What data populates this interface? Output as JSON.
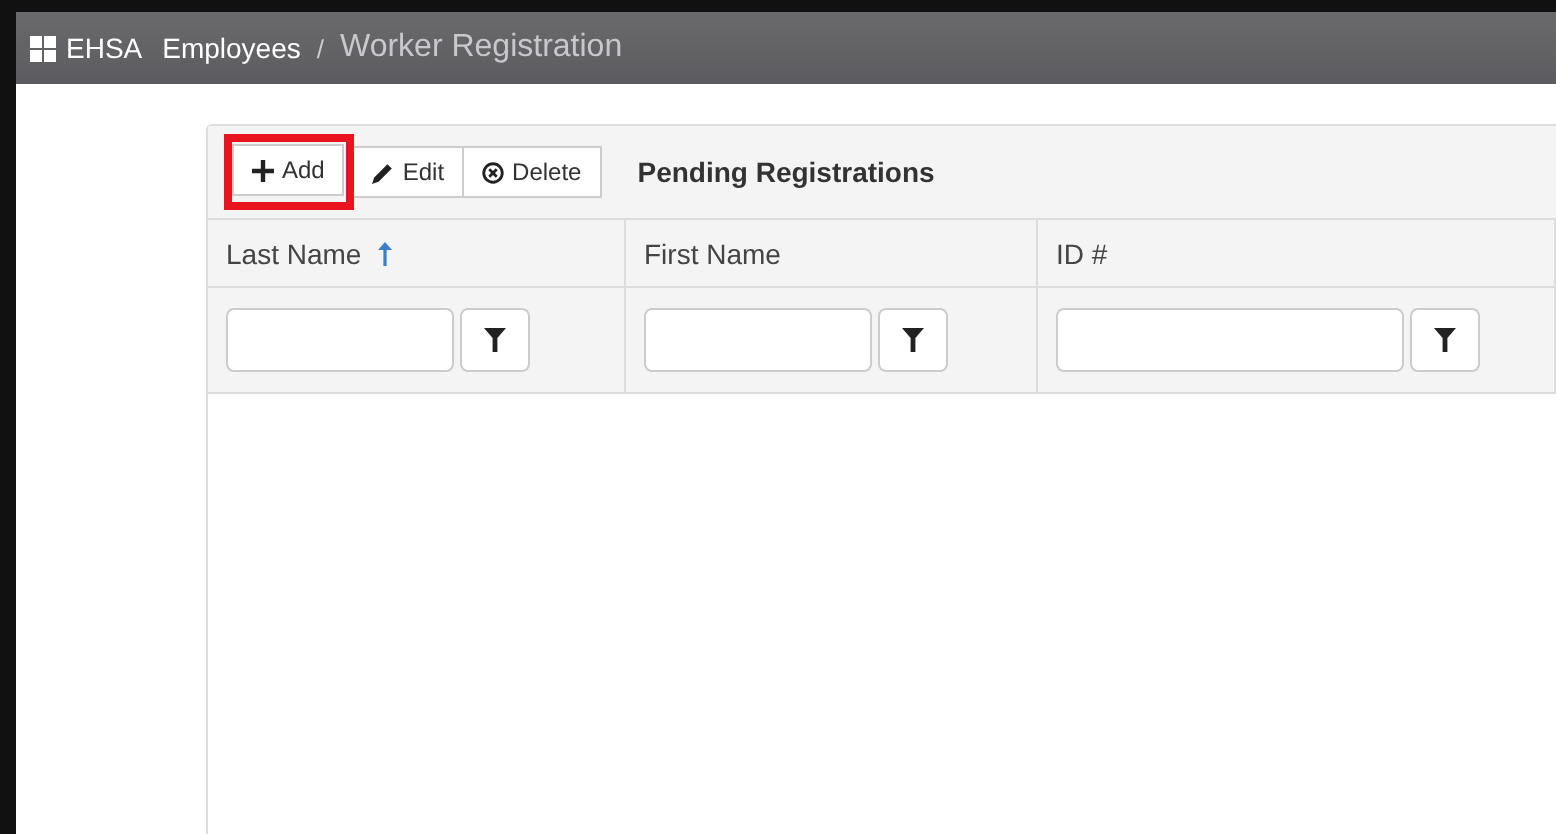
{
  "header": {
    "brand": "EHSA",
    "separator": "/",
    "breadcrumbs": [
      {
        "label": "Employees",
        "current": false
      },
      {
        "label": "Worker Registration",
        "current": true
      }
    ]
  },
  "toolbar": {
    "buttons": [
      {
        "kind": "add",
        "label": "Add",
        "highlighted": true
      },
      {
        "kind": "edit",
        "label": "Edit",
        "highlighted": false
      },
      {
        "kind": "delete",
        "label": "Delete",
        "highlighted": false
      }
    ],
    "title": "Pending Registrations"
  },
  "table": {
    "columns": [
      {
        "label": "Last Name",
        "sorted": true
      },
      {
        "label": "First Name",
        "sorted": false
      },
      {
        "label": "ID #",
        "sorted": false
      }
    ]
  }
}
